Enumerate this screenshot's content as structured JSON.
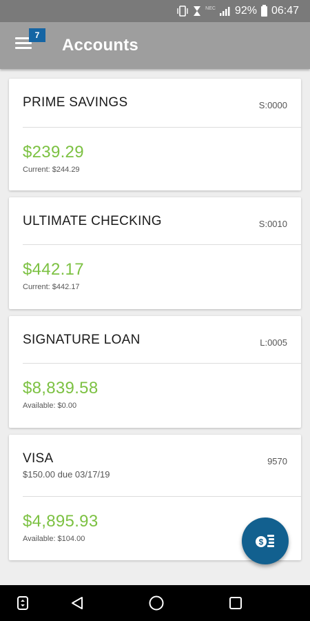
{
  "status_bar": {
    "network_label": "NEC",
    "battery": "92%",
    "time": "06:47"
  },
  "app_bar": {
    "title": "Accounts",
    "badge_count": "7"
  },
  "accounts": [
    {
      "name": "PRIME SAVINGS",
      "id": "S:0000",
      "subtitle": "",
      "balance": "$239.29",
      "detail": "Current: $244.29"
    },
    {
      "name": "ULTIMATE CHECKING",
      "id": "S:0010",
      "subtitle": "",
      "balance": "$442.17",
      "detail": "Current: $442.17"
    },
    {
      "name": "SIGNATURE LOAN",
      "id": "L:0005",
      "subtitle": "",
      "balance": "$8,839.58",
      "detail": "Available: $0.00"
    },
    {
      "name": "VISA",
      "id": "9570",
      "subtitle": "$150.00 due 03/17/19",
      "balance": "$4,895.93",
      "detail": "Available: $104.00"
    }
  ],
  "colors": {
    "app_bar": "#9e9e9e",
    "status_bar": "#7a7a7a",
    "badge": "#1565a4",
    "balance": "#7cc142",
    "fab": "#12608f"
  },
  "icons": {
    "menu": "hamburger-menu-icon",
    "fab": "transfer-money-icon",
    "nav_home": "circle-home-icon",
    "nav_back": "triangle-back-icon",
    "nav_recents": "square-recents-icon"
  }
}
